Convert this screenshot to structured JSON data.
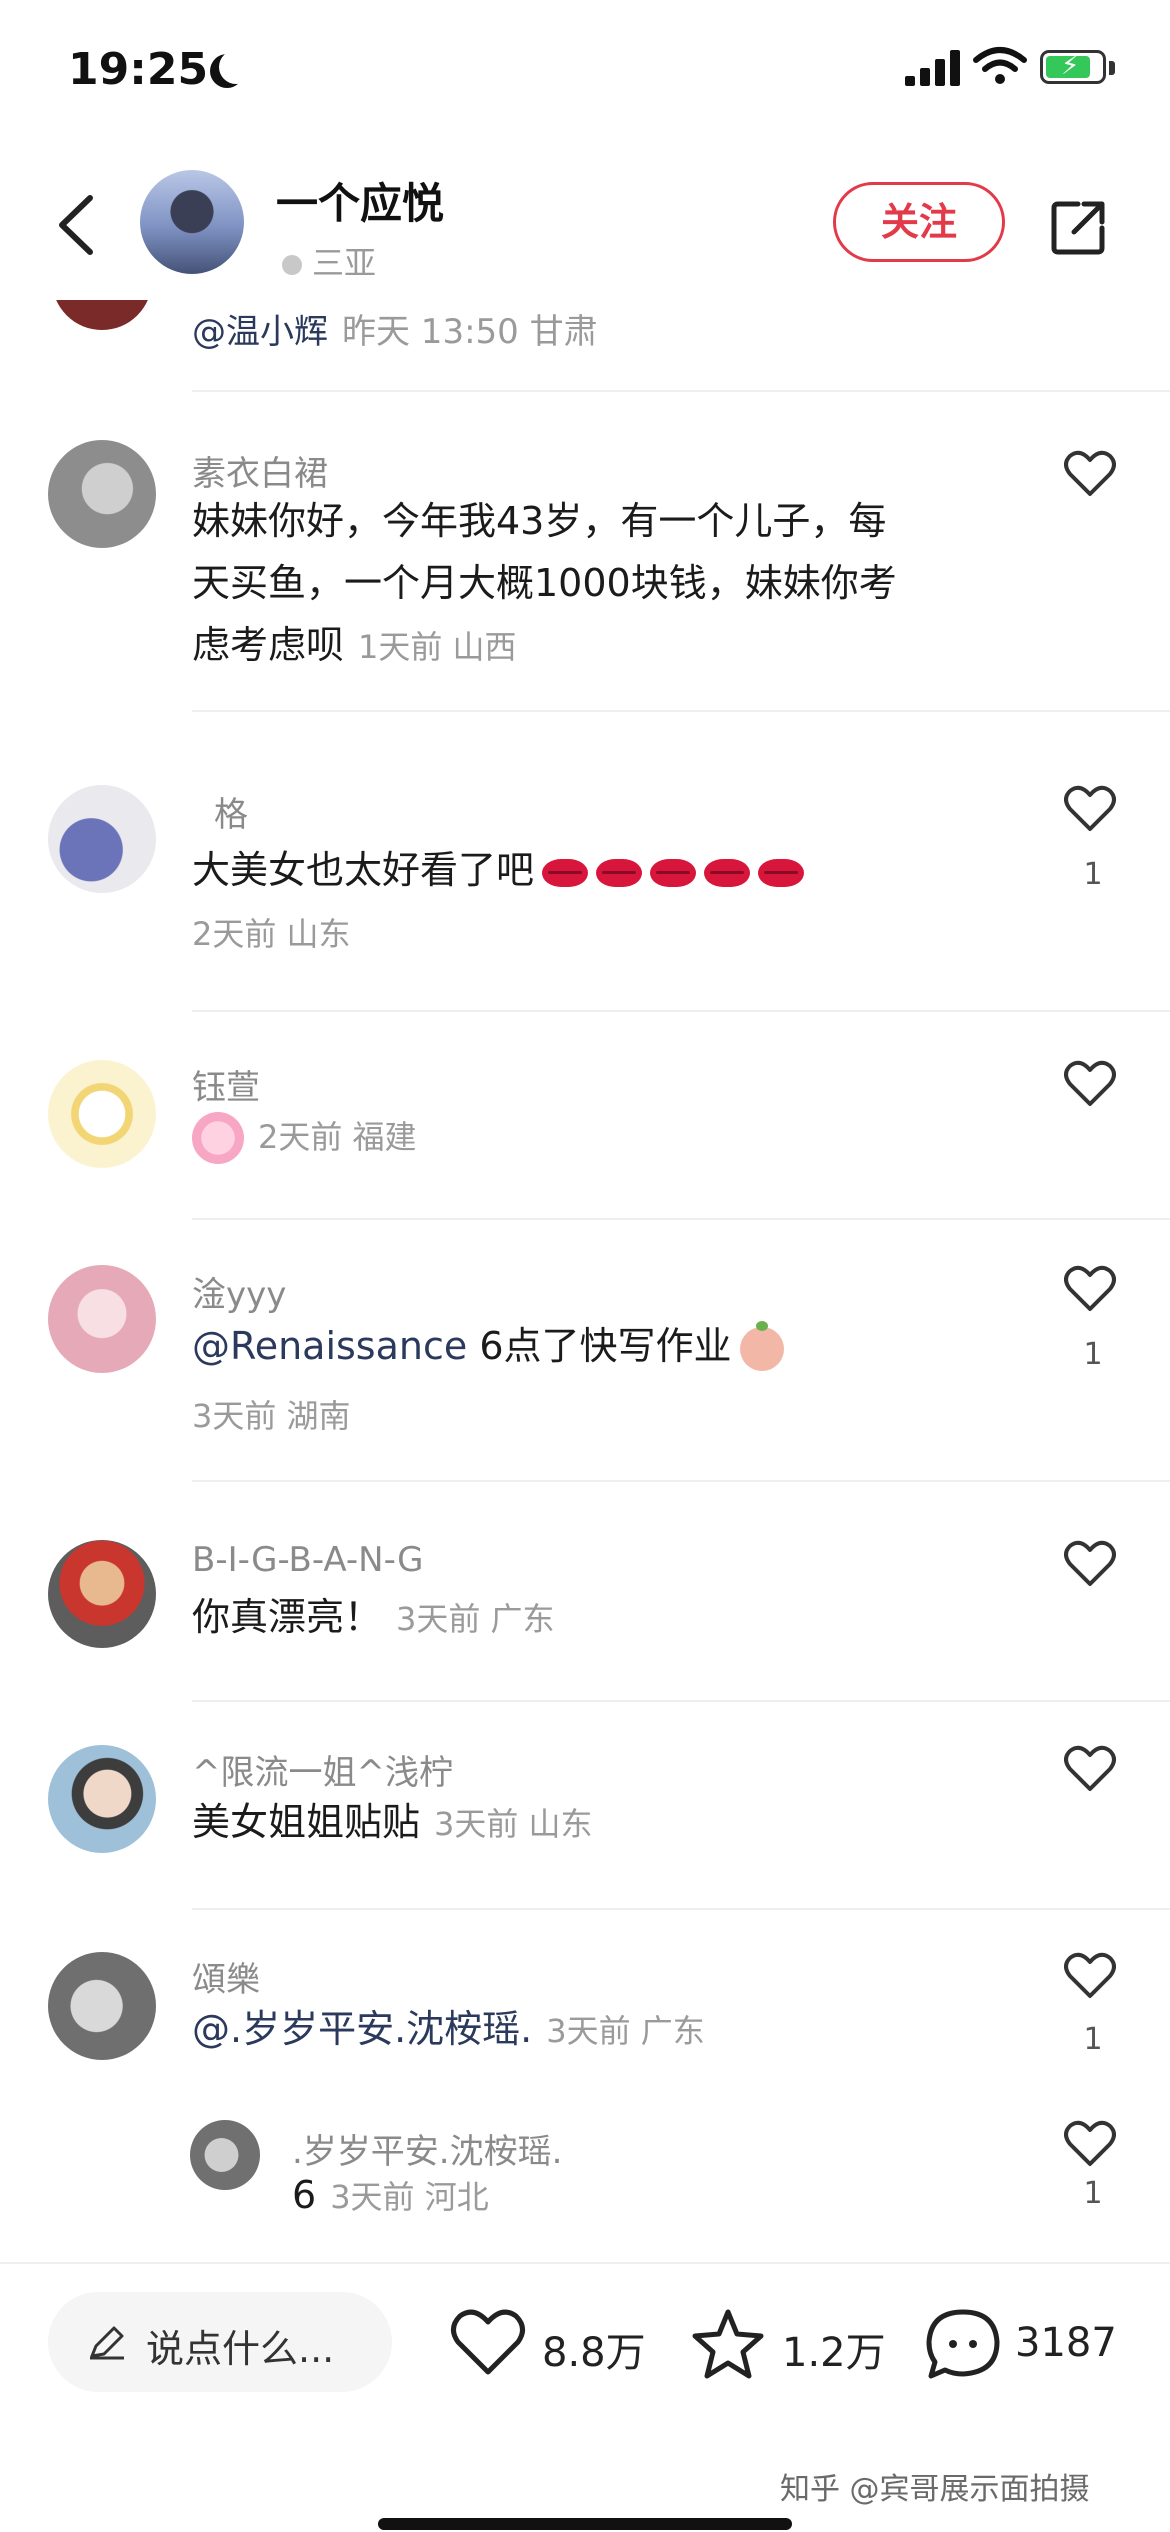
{
  "status_bar": {
    "time": "19:25"
  },
  "header": {
    "name": "一个应悦",
    "location": "三亚",
    "follow_label": "关注"
  },
  "partial_comment": {
    "text": "@温小辉",
    "meta": "昨天 13:50 甘肃"
  },
  "comments": [
    {
      "name": "素衣白裙",
      "lines": [
        "妹妹你好，今年我43岁，有一个儿子，每",
        "天买鱼，一个月大概1000块钱，妹妹你考",
        "虑考虑呗"
      ],
      "meta": "1天前 山西",
      "likes": ""
    },
    {
      "name": "格",
      "text": "大美女也太好看了吧",
      "meta": "2天前 山东",
      "likes": "1"
    },
    {
      "name": "钰萱",
      "meta": "2天前 福建",
      "likes": ""
    },
    {
      "name": "淦yyy",
      "mention": "@Renaissance",
      "text": " 6点了快写作业",
      "meta": "3天前 湖南",
      "likes": "1"
    },
    {
      "name": "B-I-G-B-A-N-G",
      "text": "你真漂亮！",
      "meta": "3天前 广东",
      "likes": ""
    },
    {
      "name": "^限流一姐^浅柠",
      "text": "美女姐姐贴贴",
      "meta": "3天前 山东",
      "likes": ""
    },
    {
      "name": "頌樂",
      "mention": "@.岁岁平安.沈桉瑶.",
      "meta": "3天前 广东",
      "likes": "1"
    },
    {
      "name": ".岁岁平安.沈桉瑶.",
      "text": "6",
      "meta": "3天前 河北",
      "likes": "1"
    }
  ],
  "bottom_bar": {
    "input_placeholder": "说点什么...",
    "likes": "8.8万",
    "favorites": "1.2万",
    "comments": "3187"
  },
  "watermark": "知乎 @宾哥展示面拍摄",
  "colors": {
    "accent": "#e23a48",
    "mention": "#2b3a5c"
  }
}
